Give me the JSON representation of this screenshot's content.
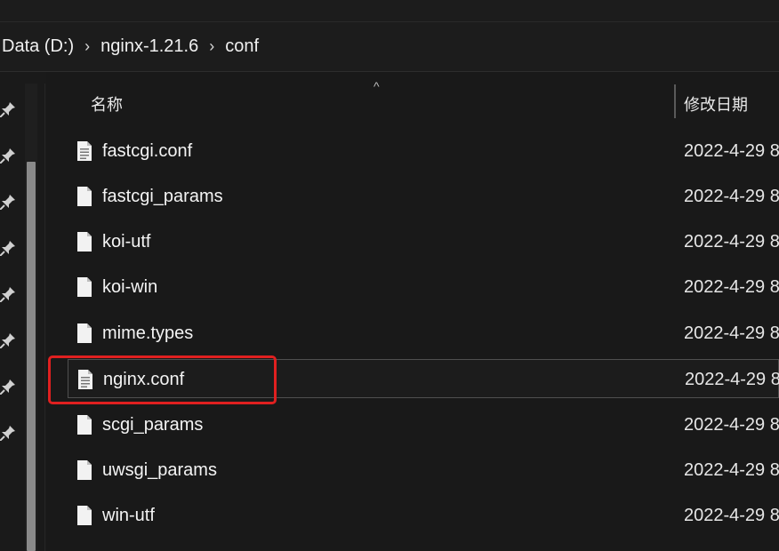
{
  "breadcrumb": [
    {
      "label": "Data (D:)"
    },
    {
      "label": "nginx-1.21.6"
    },
    {
      "label": "conf"
    }
  ],
  "breadcrumb_separator": "›",
  "columns": {
    "name": "名称",
    "date_modified": "修改日期",
    "sort_indicator": "^"
  },
  "files": [
    {
      "name": "fastcgi.conf",
      "date": "2022-4-29 8",
      "icon": "text-file-icon"
    },
    {
      "name": "fastcgi_params",
      "date": "2022-4-29 8",
      "icon": "file-icon"
    },
    {
      "name": "koi-utf",
      "date": "2022-4-29 8",
      "icon": "file-icon"
    },
    {
      "name": "koi-win",
      "date": "2022-4-29 8",
      "icon": "file-icon"
    },
    {
      "name": "mime.types",
      "date": "2022-4-29 8",
      "icon": "file-icon"
    },
    {
      "name": "nginx.conf",
      "date": "2022-4-29 8",
      "icon": "text-file-icon"
    },
    {
      "name": "scgi_params",
      "date": "2022-4-29 8",
      "icon": "file-icon"
    },
    {
      "name": "uwsgi_params",
      "date": "2022-4-29 8",
      "icon": "file-icon"
    },
    {
      "name": "win-utf",
      "date": "2022-4-29 8",
      "icon": "file-icon"
    }
  ],
  "selected_file": "nginx.conf",
  "annotation": {
    "color": "#e02020"
  },
  "quick_access_pins": 8
}
